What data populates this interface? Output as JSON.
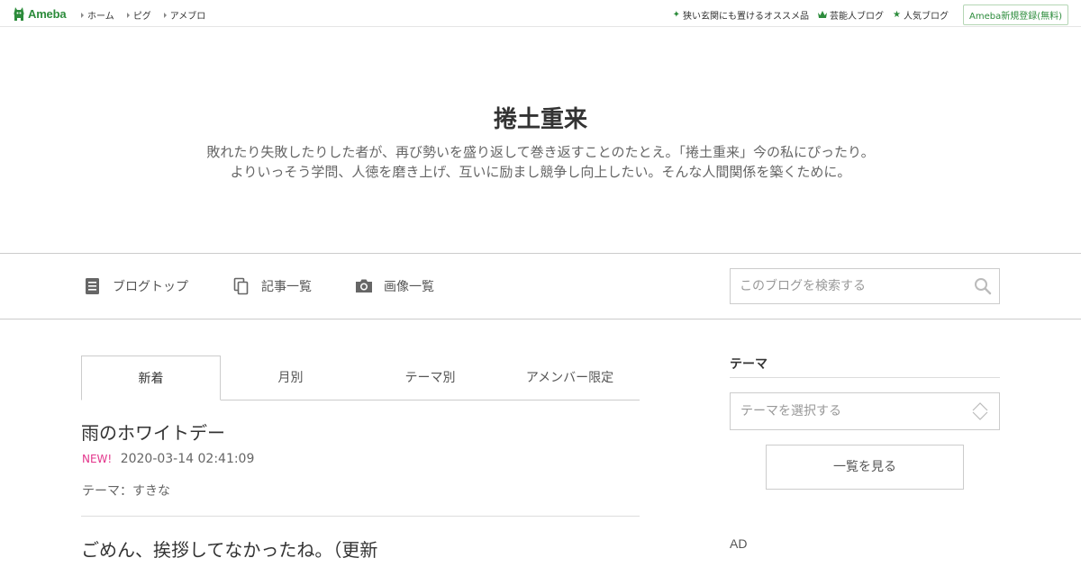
{
  "header": {
    "logo_text": "Ameba",
    "nav": [
      {
        "label": "ホーム"
      },
      {
        "label": "ピグ"
      },
      {
        "label": "アメブロ"
      }
    ],
    "right_links": [
      {
        "label": "狭い玄関にも置けるオススメ品",
        "icon": "sparkle-icon"
      },
      {
        "label": "芸能人ブログ",
        "icon": "crown-icon"
      },
      {
        "label": "人気ブログ",
        "icon": "star-icon"
      }
    ],
    "signup_label": "Ameba新規登録(無料)"
  },
  "blog": {
    "title": "捲土重来",
    "description_line1": "敗れたり失敗したりした者が、再び勢いを盛り返して巻き返すことのたとえ。「捲土重来」今の私にぴったり。",
    "description_line2": "よりいっそう学問、人徳を磨き上げ、互いに励まし競争し向上したい。そんな人間関係を築くために。"
  },
  "blognav": {
    "items": [
      {
        "label": "ブログトップ",
        "icon": "document-icon"
      },
      {
        "label": "記事一覧",
        "icon": "copy-icon"
      },
      {
        "label": "画像一覧",
        "icon": "camera-icon"
      }
    ],
    "search_placeholder": "このブログを検索する"
  },
  "tabs": [
    {
      "label": "新着",
      "active": true
    },
    {
      "label": "月別",
      "active": false
    },
    {
      "label": "テーマ別",
      "active": false
    },
    {
      "label": "アメンバー限定",
      "active": false
    }
  ],
  "articles": [
    {
      "title": "雨のホワイトデー",
      "badge": "NEW!",
      "date": "2020-03-14 02:41:09",
      "theme": "テーマ：すきな"
    },
    {
      "title": "ごめん、挨拶してなかったね。（更新"
    }
  ],
  "sidebar": {
    "theme_heading": "テーマ",
    "theme_select_placeholder": "テーマを選択する",
    "list_button_label": "一覧を見る",
    "ad_label": "AD"
  },
  "colors": {
    "brand_green": "#2d8c3c",
    "new_badge": "#e3368c",
    "border": "#cccccc"
  }
}
